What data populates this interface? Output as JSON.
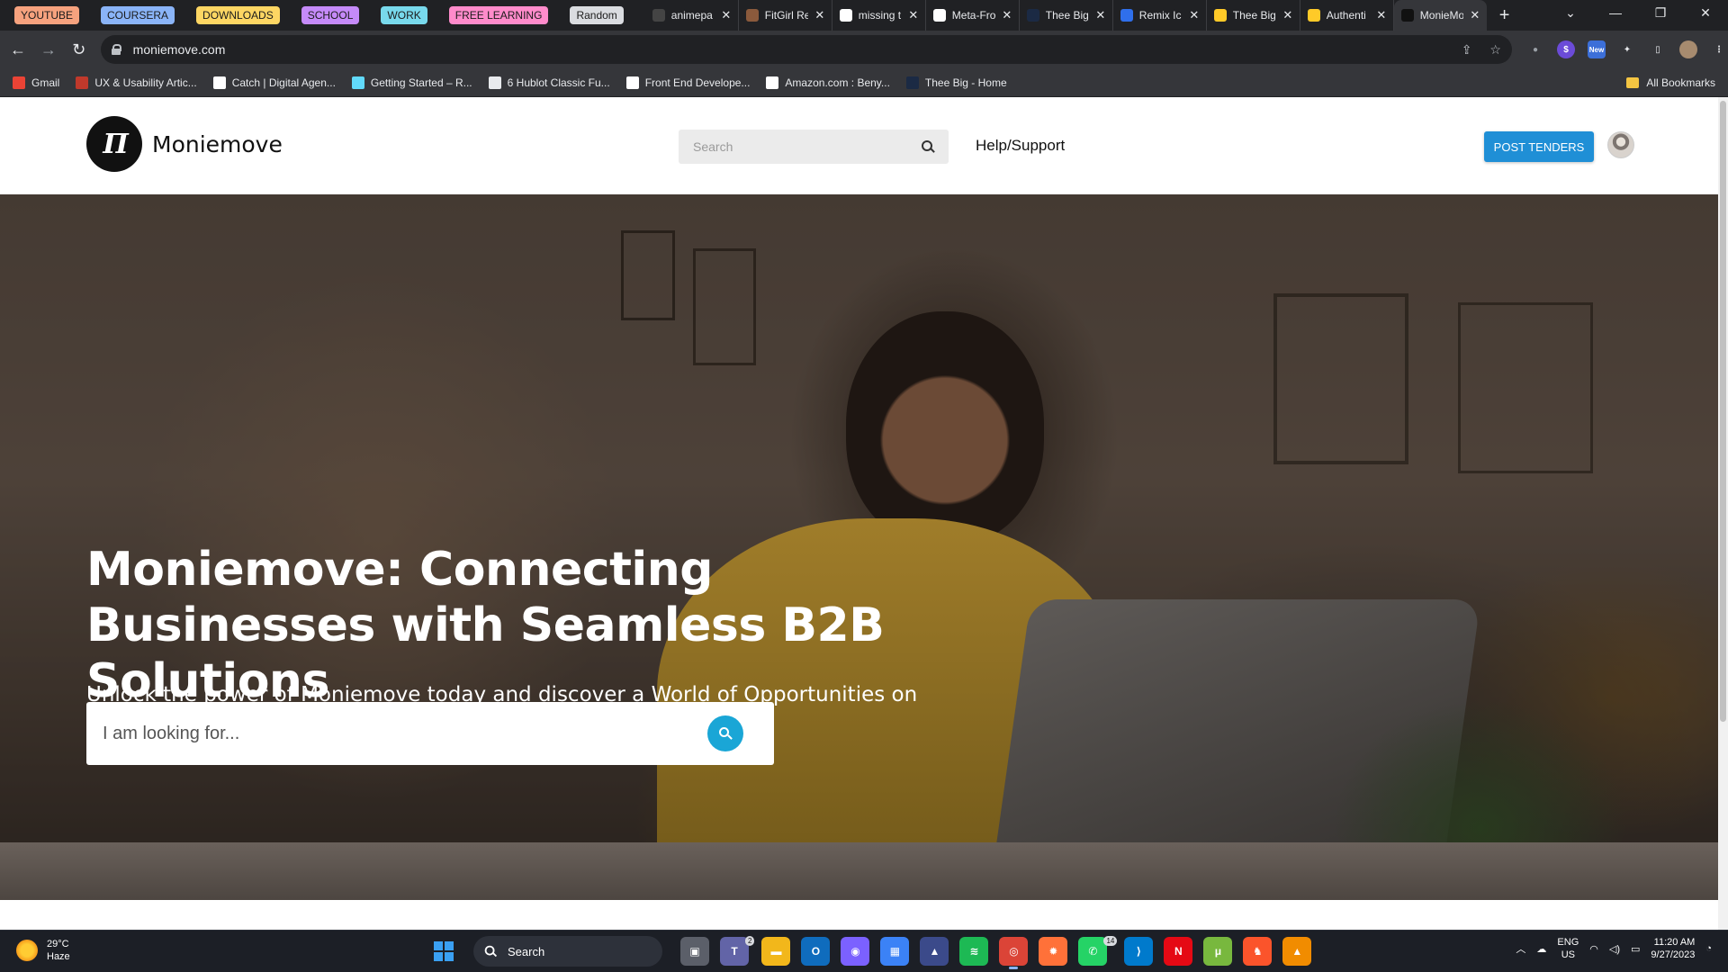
{
  "browser": {
    "tab_groups": [
      {
        "label": "YOUTUBE",
        "color": "#f6a27e"
      },
      {
        "label": "COURSERA",
        "color": "#8ab4f8"
      },
      {
        "label": "DOWNLOADS",
        "color": "#fdd663"
      },
      {
        "label": "SCHOOL",
        "color": "#c58af9"
      },
      {
        "label": "WORK",
        "color": "#78d9ec"
      },
      {
        "label": "FREE LEARNING",
        "color": "#ff8bcb"
      },
      {
        "label": "Random",
        "color": "#dadce0"
      }
    ],
    "tabs": [
      {
        "title": "animepa",
        "icon": "anime-icon",
        "color": "#444"
      },
      {
        "title": "FitGirl Re",
        "icon": "fitgirl-icon",
        "color": "#8b5a3c"
      },
      {
        "title": "missing t",
        "icon": "google-icon",
        "color": "#ffffff"
      },
      {
        "title": "Meta-Fro",
        "icon": "github-icon",
        "color": "#ffffff"
      },
      {
        "title": "Thee Big",
        "icon": "thee-big-icon",
        "color": "#1b2a44"
      },
      {
        "title": "Remix Ic",
        "icon": "remix-icon",
        "color": "#2f6feb"
      },
      {
        "title": "Thee Big",
        "icon": "firebase-icon",
        "color": "#ffca28"
      },
      {
        "title": "Authenti",
        "icon": "firebase-icon",
        "color": "#ffca28"
      },
      {
        "title": "MonieMo",
        "icon": "moniemove-icon",
        "color": "#111111",
        "active": true
      }
    ],
    "new_tab": "+",
    "url": "moniemove.com",
    "bookmarks": [
      {
        "label": "Gmail",
        "icon": "gmail-icon",
        "color": "#ea4335"
      },
      {
        "label": "UX & Usability Artic...",
        "icon": "nn-icon",
        "color": "#c0392b"
      },
      {
        "label": "Catch | Digital Agen...",
        "icon": "plus-icon",
        "color": "#ffffff"
      },
      {
        "label": "Getting Started – R...",
        "icon": "react-icon",
        "color": "#61dafb"
      },
      {
        "label": "6 Hublot Classic Fu...",
        "icon": "hublot-icon",
        "color": "#e8eaed"
      },
      {
        "label": "Front End Develope...",
        "icon": "plus-icon",
        "color": "#ffffff"
      },
      {
        "label": "Amazon.com : Beny...",
        "icon": "amazon-icon",
        "color": "#ffffff"
      },
      {
        "label": "Thee Big - Home",
        "icon": "thee-big-icon",
        "color": "#1b2a44"
      }
    ],
    "all_bookmarks": "All Bookmarks",
    "new_badge": "New"
  },
  "site": {
    "brand": "Moniemove",
    "logo_text": "Π",
    "search_placeholder": "Search",
    "help": "Help/Support",
    "post_tenders": "POST TENDERS",
    "hero": {
      "title": "Moniemove: Connecting Businesses with Seamless B2B Solutions",
      "subtitle": "Unlock the power of Moniemove today and discover a World of Opportunities on Our Ecommerce Platform",
      "search_placeholder": "I am looking for..."
    }
  },
  "taskbar": {
    "weather_temp": "29°C",
    "weather_desc": "Haze",
    "search_label": "Search",
    "apps": [
      {
        "name": "task-view-icon",
        "color": "#5b5f69",
        "glyph": "▣"
      },
      {
        "name": "teams-icon",
        "color": "#6264a7",
        "glyph": "T",
        "badge": "2"
      },
      {
        "name": "file-explorer-icon",
        "color": "#f2b71b",
        "glyph": "▬"
      },
      {
        "name": "outlook-icon",
        "color": "#0f6cbd",
        "glyph": "O"
      },
      {
        "name": "xbox-icon",
        "color": "#7b61ff",
        "glyph": "◉"
      },
      {
        "name": "store-icon",
        "color": "#3b82f6",
        "glyph": "▦"
      },
      {
        "name": "app-icon",
        "color": "#3b4a8a",
        "glyph": "▲"
      },
      {
        "name": "spotify-icon",
        "color": "#1db954",
        "glyph": "≋"
      },
      {
        "name": "chrome-icon",
        "color": "#db4437",
        "glyph": "◎",
        "active": true
      },
      {
        "name": "firefox-icon",
        "color": "#ff7139",
        "glyph": "✹"
      },
      {
        "name": "whatsapp-icon",
        "color": "#25d366",
        "glyph": "✆",
        "badge": "14"
      },
      {
        "name": "vscode-icon",
        "color": "#007acc",
        "glyph": "⟩"
      },
      {
        "name": "netflix-icon",
        "color": "#e50914",
        "glyph": "N"
      },
      {
        "name": "utorrent-icon",
        "color": "#78b83e",
        "glyph": "μ"
      },
      {
        "name": "brave-icon",
        "color": "#fb542b",
        "glyph": "♞"
      },
      {
        "name": "vlc-icon",
        "color": "#f18c00",
        "glyph": "▲"
      }
    ],
    "lang_top": "ENG",
    "lang_bottom": "US",
    "time": "11:20 AM",
    "date": "9/27/2023"
  }
}
